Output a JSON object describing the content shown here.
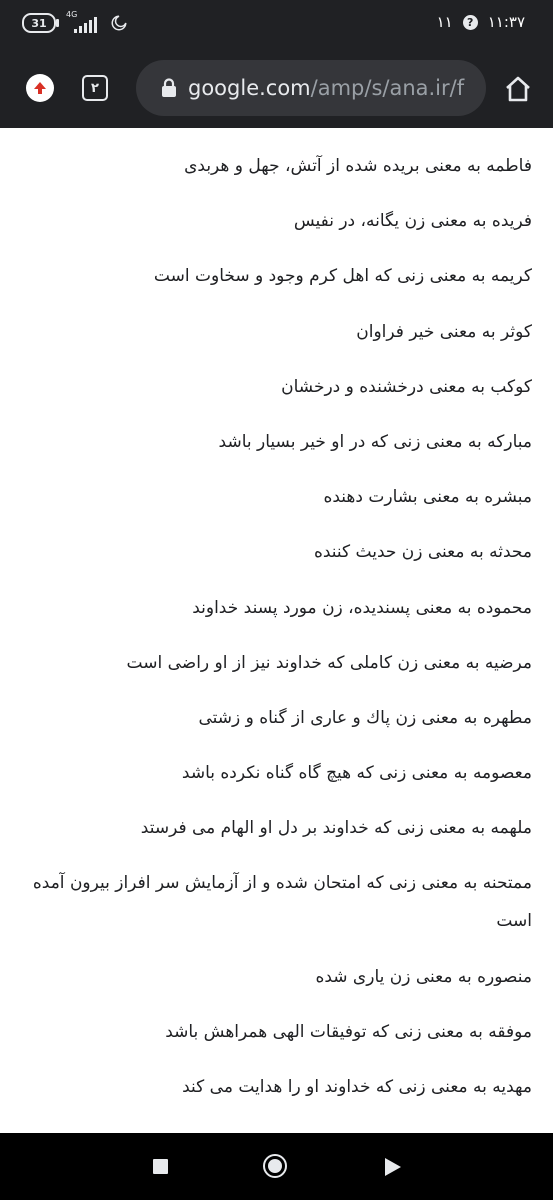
{
  "status_bar": {
    "battery": "31",
    "network": "4G",
    "time": "۱۱:۳۷",
    "notification_count": "۱۱"
  },
  "toolbar": {
    "tab_count": "۲",
    "url_host": "google.com",
    "url_path": "/amp/s/ana.ir/f"
  },
  "icons": {
    "upgrade": "arrow-up-circle-icon",
    "lock": "lock-icon",
    "home": "home-icon"
  },
  "colors": {
    "toolbar_bg": "#202124",
    "omnibox_bg": "#35363a",
    "upgrade_arrow": "#d93025",
    "text": "#202124"
  },
  "content": {
    "items": [
      "فاطمه به معنی بریده شده از آتش، جهل و هربدی",
      "فریده به معنی زن یگانه، در نفیس",
      "کریمه به معنی زنی که اهل کرم وجود و سخاوت است",
      "کوثر به معنی خیر فراوان",
      "کوکب به معنی درخشنده و درخشان",
      "مبارکه به معنی زنی که در او خیر بسیار باشد",
      "مبشره به معنی بشارت دهنده",
      "محدثه به معنی زن حدیث کننده",
      "محموده به معنی پسندیده، زن مورد پسند خداوند",
      "مرضیه به معنی زن کاملی که خداوند نیز از او راضی است",
      "مطهره به معنی زن پاك و عاری از گناه و زشتی",
      "معصومه به معنی زنی که هیچ گاه گناه نکرده باشد",
      "ملهمه به معنی زنی که خداوند بر دل او الهام می فرستد",
      "ممتحنه به معنی زنی که امتحان شده و از آزمایش سر افراز بیرون آمده است",
      "منصوره به معنی زن یاری شده",
      "موفقه به معنی زنی که توفیقات الهی همراهش باشد",
      "مهدیه به معنی زنی که خداوند او را هدایت می کند"
    ]
  }
}
